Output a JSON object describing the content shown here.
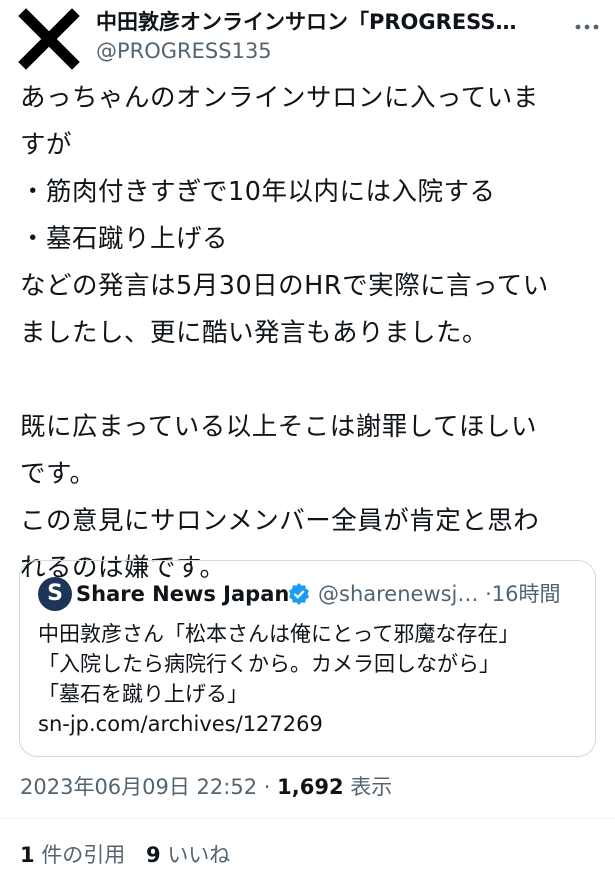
{
  "author": {
    "name": "中田敦彦オンラインサロン「PROGRESS…",
    "handle": "@PROGRESS135"
  },
  "tweet": {
    "lines": [
      "あっちゃんのオンラインサロンに入っていま",
      "すが",
      "・筋肉付きすぎで10年以内には入院する",
      "・墓石蹴り上げる",
      "などの発言は5月30日のHRで実際に言ってい",
      "ましたし、更に酷い発言もありました。",
      "",
      "既に広まっている以上そこは謝罪してほしい",
      "です。",
      "この意見にサロンメンバー全員が肯定と思わ",
      "れるのは嫌です。"
    ]
  },
  "quote": {
    "avatar_letter": "S",
    "name": "Share News Japan",
    "handle": "@sharenewsj…",
    "separator": "·",
    "time": "16時間",
    "lines": [
      "中田敦彦さん「松本さんは俺にとって邪魔な存在」",
      "「入院したら病院行くから。カメラ回しながら」",
      "「墓石を蹴り上げる」",
      "sn-jp.com/archives/127269"
    ]
  },
  "meta": {
    "datetime": "2023年06月09日 22:52",
    "separator": "·",
    "views_count": "1,692",
    "views_label": "表示"
  },
  "stats": {
    "quotes_count": "1",
    "quotes_label": "件の引用",
    "likes_count": "9",
    "likes_label": "いいね"
  },
  "colors": {
    "text": "#0f1419",
    "secondary": "#536471",
    "verified": "#1d9bf0",
    "border": "#cfd9de"
  },
  "icons": {
    "avatar": "x-cross-icon",
    "more": "more-dots-icon",
    "verified": "verified-badge-icon"
  }
}
